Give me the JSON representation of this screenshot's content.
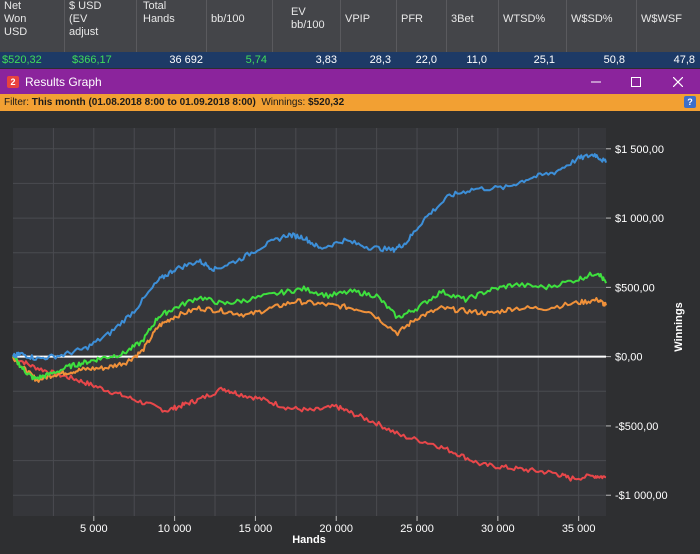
{
  "header": {
    "columns": [
      {
        "label": "Net\nWon\nUSD",
        "value": "$520,32",
        "color": "green"
      },
      {
        "label": "$ USD\n(EV\nadjust",
        "value": "$366,17",
        "color": "green"
      },
      {
        "label": "Total\nHands",
        "value": "36 692",
        "color": "white"
      },
      {
        "label": "bb/100",
        "value": "5,74",
        "color": "green"
      },
      {
        "label": "EV\nbb/100",
        "value": "3,83",
        "color": "white"
      },
      {
        "label": "VPIP",
        "value": "28,3",
        "color": "white"
      },
      {
        "label": "PFR",
        "value": "22,0",
        "color": "white"
      },
      {
        "label": "3Bet",
        "value": "11,0",
        "color": "white"
      },
      {
        "label": "WTSD%",
        "value": "25,1",
        "color": "white"
      },
      {
        "label": "W$SD%",
        "value": "50,8",
        "color": "white"
      },
      {
        "label": "W$WSF",
        "value": "47,8",
        "color": "white"
      }
    ]
  },
  "window": {
    "badge": "2",
    "title": "Results Graph"
  },
  "filter": {
    "prefix": "Filter: ",
    "period": "This month (01.08.2018 8:00 to 01.09.2018 8:00)",
    "winnings_label": "  Winnings: ",
    "winnings_value": "$520,32",
    "help": "?"
  },
  "chart_data": {
    "type": "line",
    "xlabel": "Hands",
    "ylabel": "Winnings",
    "xlim": [
      0,
      36692
    ],
    "ylim": [
      -1150,
      1650
    ],
    "x_ticks": [
      5000,
      10000,
      15000,
      20000,
      25000,
      30000,
      35000
    ],
    "x_tick_labels": [
      "5 000",
      "10 000",
      "15 000",
      "20 000",
      "25 000",
      "30 000",
      "35 000"
    ],
    "y_ticks": [
      1500,
      1000,
      500,
      0,
      -500,
      -1000
    ],
    "y_tick_labels": [
      "$1 500,00",
      "$1 000,00",
      "$500,00",
      "$0,00",
      "-$500,00",
      "-$1 000,00"
    ],
    "grid": true,
    "colors": {
      "blue": "#3d8fd8",
      "green": "#3ee03e",
      "orange": "#f0913a",
      "red": "#e8474a",
      "zero": "#ffffff"
    },
    "series": [
      {
        "color": "blue",
        "x": [
          0,
          500,
          1500,
          3000,
          4500,
          6000,
          7500,
          9000,
          10000,
          11500,
          12500,
          14000,
          15500,
          17000,
          18000,
          19000,
          20500,
          22000,
          23500,
          24300,
          25500,
          27000,
          28500,
          30500,
          32000,
          33500,
          35000,
          36000,
          36692
        ],
        "y": [
          0,
          20,
          -15,
          10,
          60,
          170,
          330,
          550,
          630,
          690,
          630,
          700,
          800,
          880,
          860,
          780,
          840,
          790,
          770,
          820,
          1000,
          1160,
          1210,
          1220,
          1290,
          1330,
          1430,
          1460,
          1400
        ]
      },
      {
        "color": "green",
        "x": [
          0,
          700,
          1300,
          2200,
          3500,
          4500,
          5500,
          6800,
          8000,
          9000,
          10000,
          11500,
          13000,
          14500,
          16500,
          18000,
          19500,
          21000,
          22500,
          23800,
          25000,
          26500,
          28000,
          29500,
          31000,
          33000,
          35000,
          36200,
          36692
        ],
        "y": [
          0,
          -100,
          -160,
          -130,
          -70,
          -40,
          -10,
          20,
          110,
          290,
          350,
          430,
          380,
          410,
          460,
          490,
          440,
          470,
          440,
          280,
          350,
          470,
          410,
          480,
          520,
          500,
          560,
          610,
          530
        ]
      },
      {
        "color": "orange",
        "x": [
          0,
          700,
          1500,
          2500,
          3500,
          4500,
          5800,
          7000,
          8000,
          9000,
          10000,
          11500,
          13000,
          14500,
          16000,
          17500,
          19000,
          20500,
          22000,
          23800,
          25000,
          26500,
          28000,
          29500,
          31000,
          33000,
          35000,
          36200,
          36692
        ],
        "y": [
          0,
          -90,
          -170,
          -130,
          -110,
          -90,
          -80,
          -40,
          40,
          220,
          290,
          350,
          330,
          300,
          350,
          400,
          380,
          360,
          330,
          170,
          280,
          350,
          330,
          310,
          350,
          350,
          390,
          410,
          370
        ]
      },
      {
        "color": "red",
        "x": [
          0,
          1200,
          2500,
          3800,
          5000,
          6500,
          8000,
          9500,
          10500,
          11500,
          13000,
          14000,
          15500,
          17000,
          18500,
          20000,
          21000,
          22500,
          24000,
          26000,
          27500,
          29000,
          30500,
          32000,
          33500,
          34500,
          36000,
          36692
        ],
        "y": [
          0,
          -70,
          -120,
          -160,
          -210,
          -270,
          -330,
          -390,
          -350,
          -310,
          -230,
          -270,
          -310,
          -370,
          -390,
          -360,
          -410,
          -480,
          -570,
          -630,
          -700,
          -780,
          -800,
          -820,
          -840,
          -880,
          -860,
          -870
        ]
      }
    ]
  }
}
